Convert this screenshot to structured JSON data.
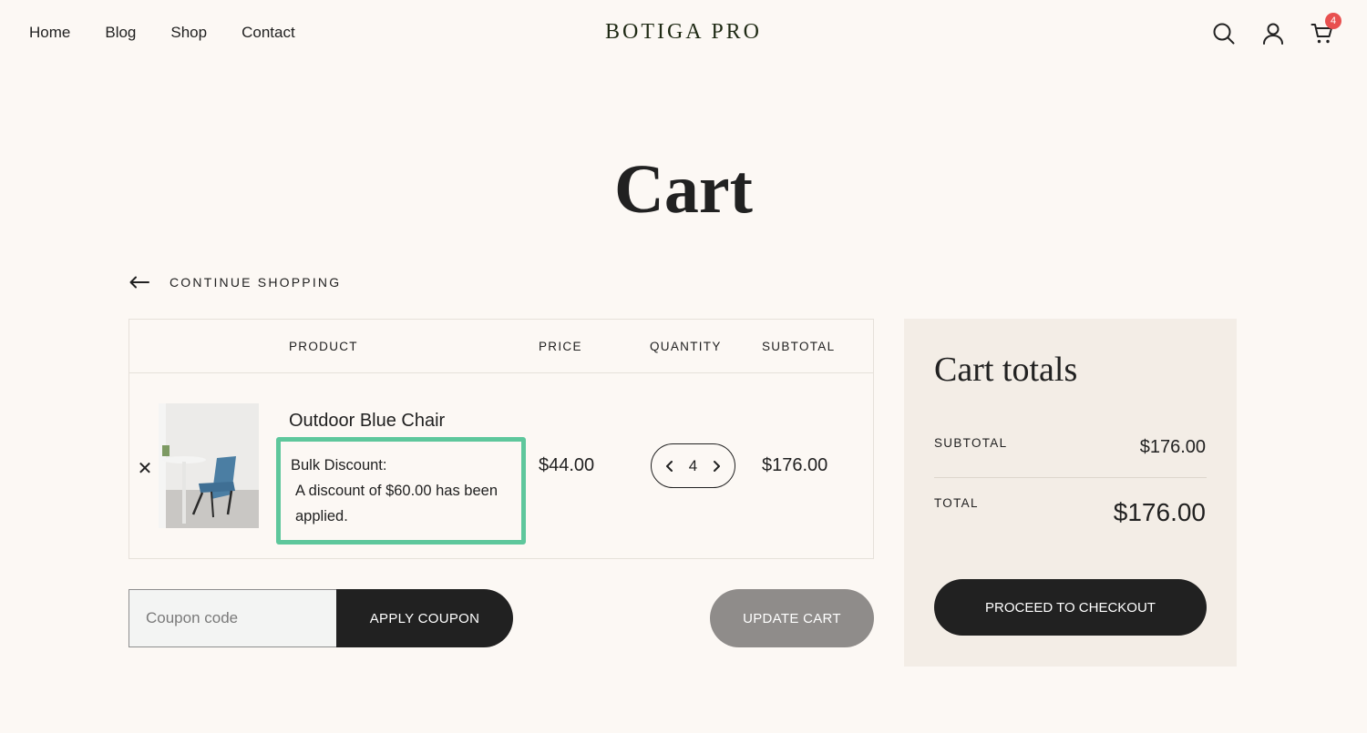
{
  "header": {
    "nav": [
      "Home",
      "Blog",
      "Shop",
      "Contact"
    ],
    "logo": "BOTIGA PRO",
    "cart_count": "4",
    "icons": [
      "search-icon",
      "user-icon",
      "cart-icon"
    ]
  },
  "page": {
    "title": "Cart",
    "continue_shopping": "CONTINUE SHOPPING"
  },
  "table": {
    "headers": {
      "product": "PRODUCT",
      "price": "PRICE",
      "quantity": "QUANTITY",
      "subtotal": "SUBTOTAL"
    },
    "items": [
      {
        "name": "Outdoor Blue Chair",
        "discount_label": "Bulk Discount:",
        "discount_text": "A discount of $60.00 has been applied.",
        "price": "$44.00",
        "quantity": "4",
        "subtotal": "$176.00"
      }
    ]
  },
  "coupon": {
    "placeholder": "Coupon code",
    "apply_label": "APPLY COUPON",
    "update_label": "UPDATE CART"
  },
  "totals": {
    "title": "Cart totals",
    "subtotal_label": "SUBTOTAL",
    "subtotal_value": "$176.00",
    "total_label": "TOTAL",
    "total_value": "$176.00",
    "checkout_label": "PROCEED TO CHECKOUT"
  },
  "colors": {
    "background": "#fcf8f4",
    "accent_border": "#5ec79c",
    "badge": "#e8504f",
    "dark_button": "#212121",
    "update_button": "#8f8c8a",
    "totals_panel": "#f3ede6"
  }
}
